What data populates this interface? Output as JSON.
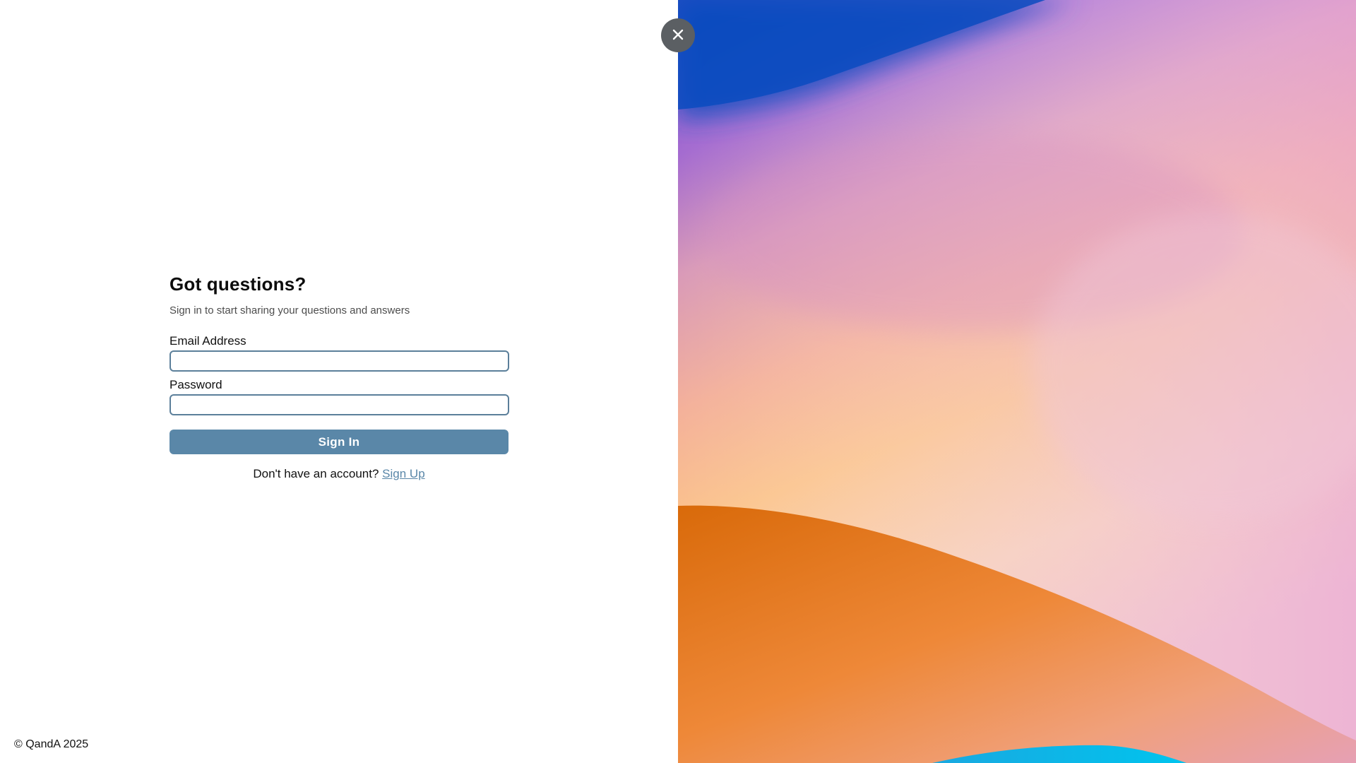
{
  "auth": {
    "title": "Got questions?",
    "subtitle": "Sign in to start sharing your questions and answers",
    "email_label": "Email Address",
    "email_value": "",
    "password_label": "Password",
    "password_value": "",
    "signin_label": "Sign In",
    "signup_prompt": "Don't have an account?",
    "signup_link": "Sign Up"
  },
  "footer": {
    "copyright": "© QandA 2025"
  },
  "close": {
    "icon": "close-icon",
    "symbol": "✕"
  },
  "colors": {
    "accent": "#5a87a8",
    "input_border": "#5b7f9a",
    "close_bg": "#5b5f63"
  }
}
